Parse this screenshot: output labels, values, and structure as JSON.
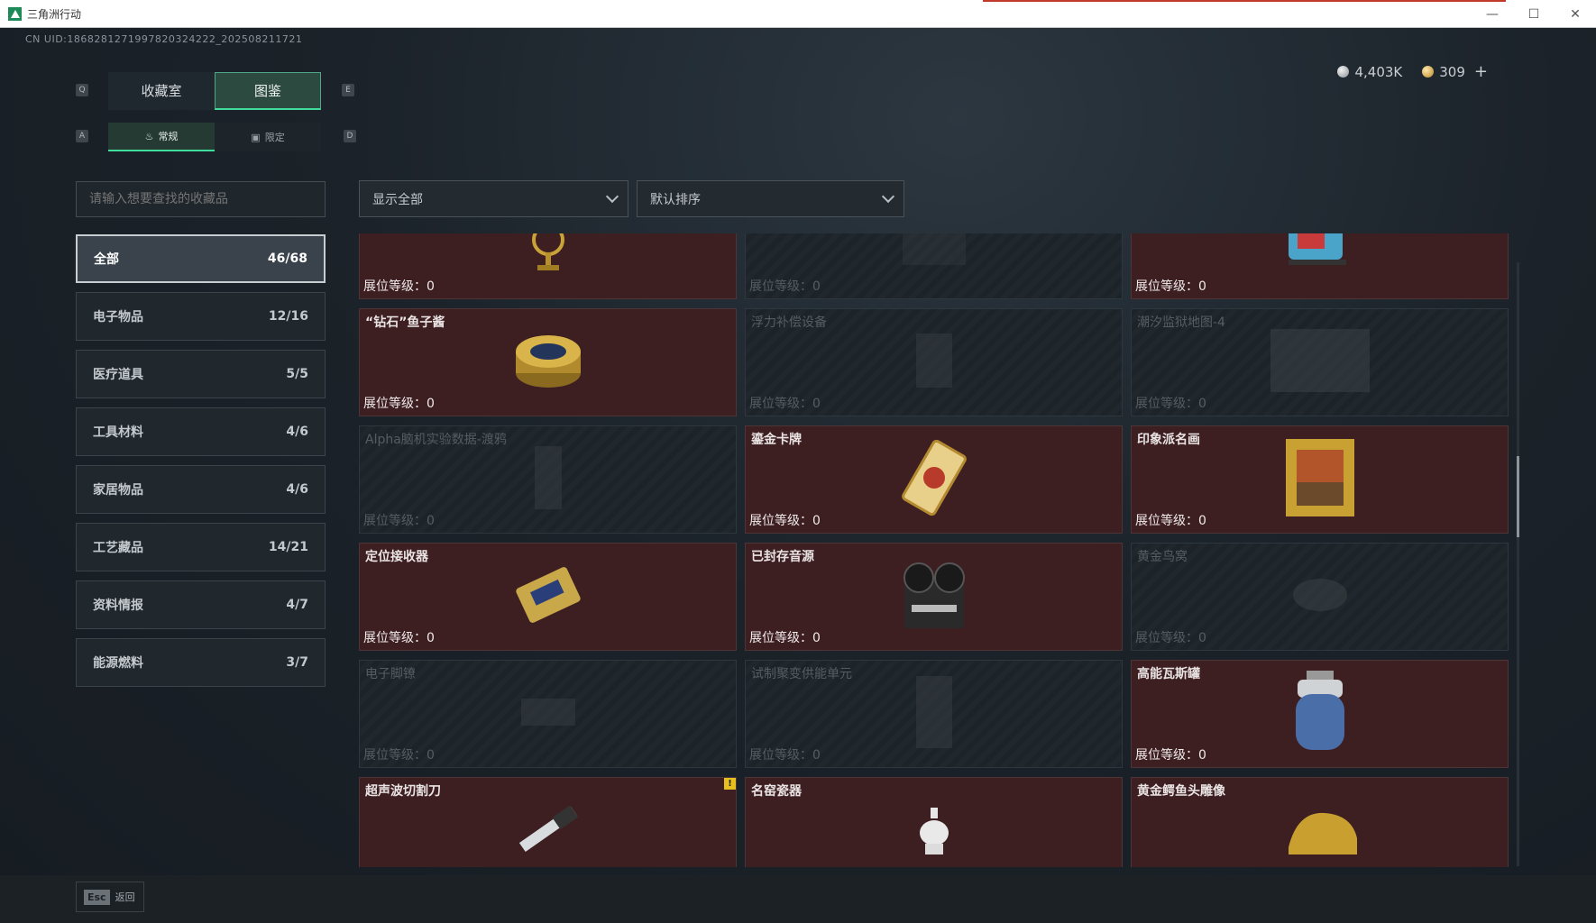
{
  "window": {
    "title": "三角洲行动",
    "minimize": "—",
    "maximize": "☐",
    "close": "✕"
  },
  "uid": "CN UID:1868281271997820324222_202508211721",
  "currency": {
    "silver": "4,403K",
    "gold": "309",
    "plus": "+"
  },
  "keys": {
    "prev_tab": "Q",
    "next_tab": "E",
    "prev_sub": "A",
    "next_sub": "D"
  },
  "tabs": [
    {
      "label": "收藏室"
    },
    {
      "label": "图鉴"
    }
  ],
  "subtabs": [
    {
      "label": "常规",
      "icon": "flame-icon"
    },
    {
      "label": "限定",
      "icon": "picture-icon"
    }
  ],
  "search": {
    "placeholder": "请输入想要查找的收藏品"
  },
  "filter": {
    "value": "显示全部"
  },
  "sort": {
    "value": "默认排序"
  },
  "categories": [
    {
      "label": "全部",
      "count": "46/68"
    },
    {
      "label": "电子物品",
      "count": "12/16"
    },
    {
      "label": "医疗道具",
      "count": "5/5"
    },
    {
      "label": "工具材料",
      "count": "4/6"
    },
    {
      "label": "家居物品",
      "count": "4/6"
    },
    {
      "label": "工艺藏品",
      "count": "14/21"
    },
    {
      "label": "资料情报",
      "count": "4/7"
    },
    {
      "label": "能源燃料",
      "count": "3/7"
    }
  ],
  "level_label": "展位等级：",
  "items": [
    {
      "name": "",
      "level": "0",
      "owned": true,
      "icon": "armillary-sphere-icon"
    },
    {
      "name": "",
      "level": "0",
      "owned": false,
      "icon": "device-icon"
    },
    {
      "name": "",
      "level": "0",
      "owned": true,
      "icon": "engine-icon"
    },
    {
      "name": "“钻石”鱼子酱",
      "level": "0",
      "owned": true,
      "icon": "caviar-tin-icon"
    },
    {
      "name": "浮力补偿设备",
      "level": "0",
      "owned": false,
      "icon": "vest-icon"
    },
    {
      "name": "潮汐监狱地图-4",
      "level": "0",
      "owned": false,
      "icon": "map-icon"
    },
    {
      "name": "Alpha脑机实验数据-渡鸦",
      "level": "0",
      "owned": false,
      "icon": "drive-icon"
    },
    {
      "name": "鎏金卡牌",
      "level": "0",
      "owned": true,
      "icon": "card-icon"
    },
    {
      "name": "印象派名画",
      "level": "0",
      "owned": true,
      "icon": "painting-icon"
    },
    {
      "name": "定位接收器",
      "level": "0",
      "owned": true,
      "icon": "receiver-icon"
    },
    {
      "name": "已封存音源",
      "level": "0",
      "owned": true,
      "icon": "tape-recorder-icon"
    },
    {
      "name": "黄金鸟窝",
      "level": "0",
      "owned": false,
      "icon": "nest-icon"
    },
    {
      "name": "电子脚镣",
      "level": "0",
      "owned": false,
      "icon": "ankle-monitor-icon"
    },
    {
      "name": "试制聚变供能单元",
      "level": "0",
      "owned": false,
      "icon": "fusion-cell-icon"
    },
    {
      "name": "高能瓦斯罐",
      "level": "0",
      "owned": true,
      "icon": "gas-canister-icon"
    },
    {
      "name": "超声波切割刀",
      "level": "",
      "owned": true,
      "icon": "cutter-icon",
      "warning": "!"
    },
    {
      "name": "名窑瓷器",
      "level": "",
      "owned": true,
      "icon": "porcelain-icon"
    },
    {
      "name": "黄金鳄鱼头雕像",
      "level": "",
      "owned": true,
      "icon": "crocodile-head-icon"
    }
  ],
  "footer": {
    "key": "Esc",
    "label": "返回"
  }
}
